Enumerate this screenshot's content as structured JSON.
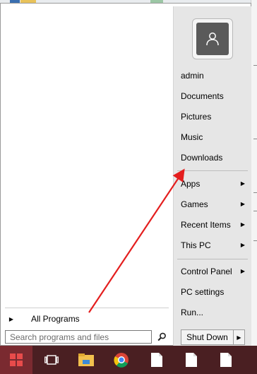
{
  "left_pane": {
    "all_programs_label": "All Programs",
    "search_placeholder": "Search programs and files"
  },
  "right_pane": {
    "items": [
      {
        "label": "admin"
      },
      {
        "label": "Documents"
      },
      {
        "label": "Pictures"
      },
      {
        "label": "Music"
      },
      {
        "label": "Downloads"
      },
      {
        "label": "Apps",
        "submenu": true
      },
      {
        "label": "Games",
        "submenu": true
      },
      {
        "label": "Recent Items",
        "submenu": true
      },
      {
        "label": "This PC",
        "submenu": true
      },
      {
        "label": "Control Panel",
        "submenu": true
      },
      {
        "label": "PC settings"
      },
      {
        "label": "Run..."
      }
    ],
    "shutdown_label": "Shut Down"
  },
  "annotation": {
    "color": "#e41e1e"
  },
  "taskbar": {
    "background": "#4a1f22",
    "buttons": [
      "windows-start",
      "task-view",
      "file-explorer",
      "chrome",
      "document",
      "document",
      "document"
    ]
  }
}
